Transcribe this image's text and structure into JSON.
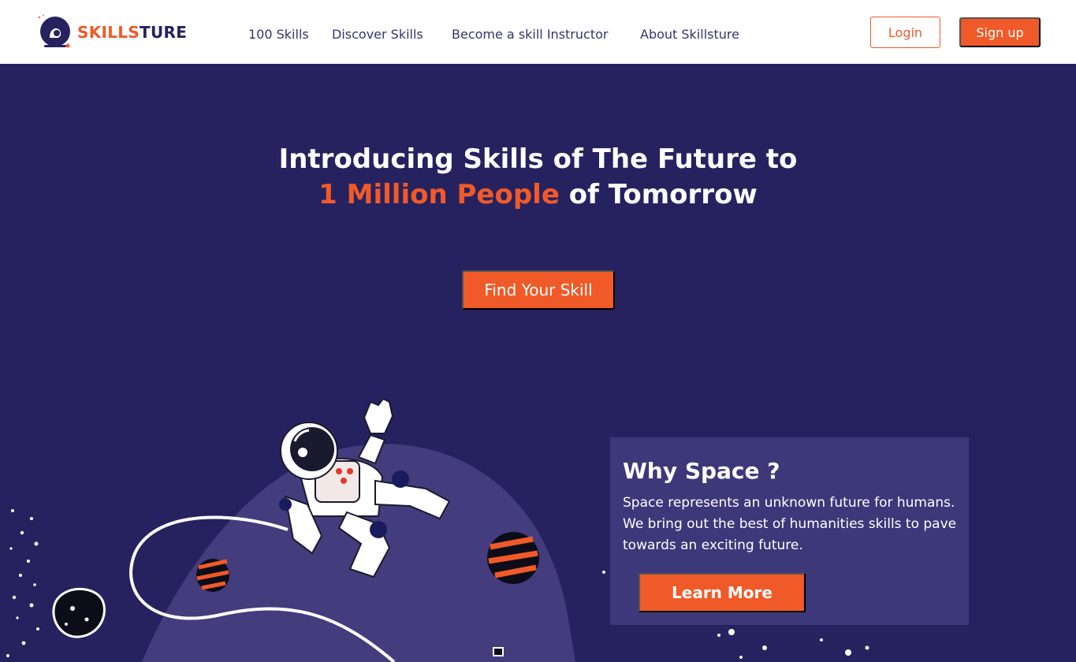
{
  "brand": {
    "name_part1": "SKILLS",
    "name_part2": "TURE",
    "accent_color": "#f05a28",
    "primary_color": "#262260",
    "logo_icon": "astronaut-helmet-icon"
  },
  "nav": {
    "links": [
      {
        "label": "100 Skills"
      },
      {
        "label": "Discover Skills"
      },
      {
        "label": "Become a skill Instructor"
      },
      {
        "label": "About Skillsture"
      }
    ],
    "login_label": "Login",
    "signup_label": "Sign up"
  },
  "hero": {
    "title_line1": "Introducing Skills of The Future to",
    "title_line2_accent": "1 Million People",
    "title_line2_rest": " of Tomorrow",
    "cta_label": "Find Your Skill",
    "background_color": "#262260"
  },
  "illustration": {
    "icons": [
      "astronaut-icon",
      "planet-icon",
      "asteroid-icon",
      "tether-cable-icon",
      "stars-icon"
    ]
  },
  "why_space": {
    "title": "Why Space ?",
    "text": "Space represents an unknown future for humans. We bring out the best of humanities skills to pave towards an exciting future.",
    "button_label": "Learn More",
    "card_color": "#3d3879"
  }
}
